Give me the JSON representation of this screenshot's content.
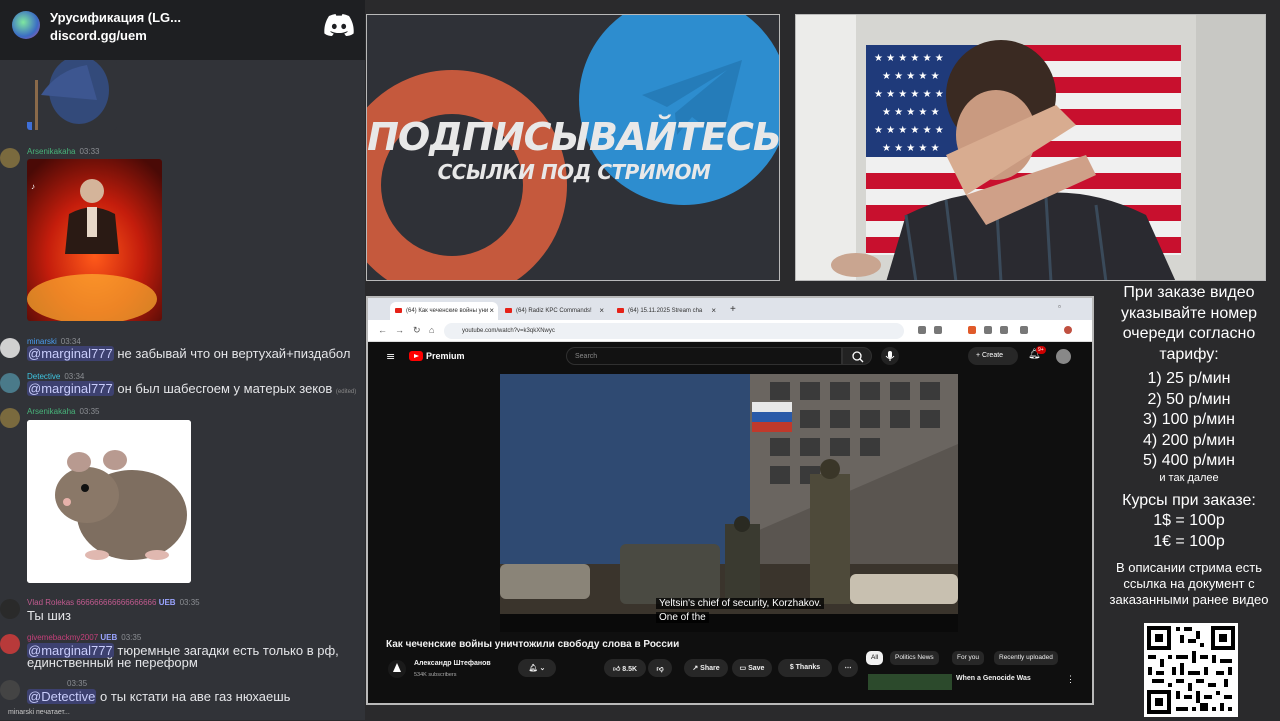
{
  "chat": {
    "server_name": "Урусификация (LG...",
    "server_link": "discord.gg/uem",
    "messages": [
      {
        "user": "Arsenikakaha",
        "time": "03:33"
      },
      {
        "user": "minarski",
        "time": "03:34",
        "mention": "@marginal777",
        "text": "не забывай что он вертухай+пиздабол"
      },
      {
        "user": "Detective",
        "time": "03:34",
        "mention": "@marginal777",
        "text": "он был шабесгоем у матерых зеков",
        "tag": "(edited)"
      },
      {
        "user": "Arsenikakaha",
        "time": "03:35"
      },
      {
        "user": "Vlad Rolekas 666666666666666666",
        "time": "03:35",
        "badge": "UEB",
        "text": "Ты шиз"
      },
      {
        "user": "givemebackmy2007",
        "time": "03:35",
        "badge": "UEB",
        "mention": "@marginal777",
        "text": "тюремные загадки есть только в рф,",
        "text2": "единственный не переформ"
      },
      {
        "user": "",
        "time": "03:35",
        "mention": "@Detective",
        "text": "о ты кстати на аве газ нюхаешь"
      }
    ],
    "typing": "minarski печатает..."
  },
  "banner": {
    "title": "ПОДПИСЫВАЙТЕСЬ",
    "subtitle": "ССЫЛКИ ПОД СТРИМОМ"
  },
  "browser": {
    "tabs": [
      "(64) Как чеченские войны уни",
      "(64) Radiz KPC Commands!",
      "(64) 15.11.2025 Stream cha"
    ],
    "url": "youtube.com/watch?v=k3qkXNwyc",
    "yt": {
      "brand": "Premium",
      "search_placeholder": "Search",
      "create": "Create",
      "notifications": "9+",
      "subtitle_line1": "Yeltsin's chief of security, Korzhakov.",
      "subtitle_line2": "One of the",
      "video_title": "Как чеченские войны уничтожили свободу слова в России",
      "channel": "Александр Штефанов",
      "subscribers": "534K subscribers",
      "likes": "8.5K",
      "share": "Share",
      "save": "Save",
      "thanks": "Thanks",
      "chips": [
        "All",
        "Politics News",
        "For you",
        "Recently uploaded"
      ],
      "rec_title": "When a Genocide Was"
    }
  },
  "info": {
    "intro": "При заказе видео указывайте номер очереди согласно тарифу:",
    "rates": [
      "1) 25 р/мин",
      "2) 50 р/мин",
      "3) 100 р/мин",
      "4) 200 р/мин",
      "5) 400 р/мин"
    ],
    "etc": "и так далее",
    "courses_title": "Курсы при заказе:",
    "courses": [
      "1$ = 100р",
      "1€ = 100р"
    ],
    "description": "В описании стрима есть ссылка на документ с заказанными ранее видео"
  }
}
